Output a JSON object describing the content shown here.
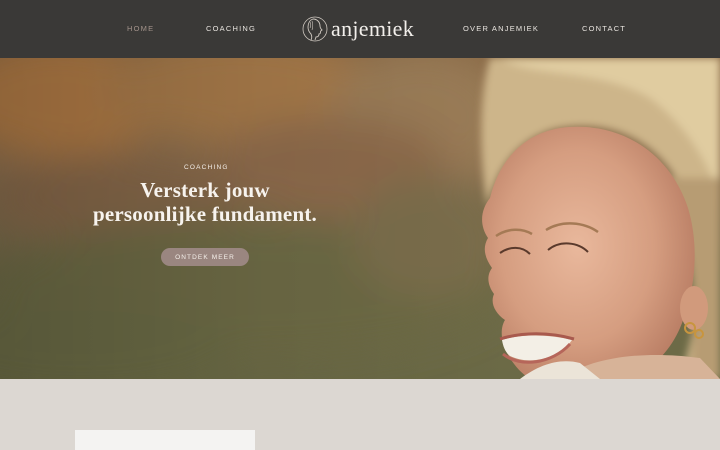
{
  "nav": {
    "left_links": [
      {
        "label": "HOME",
        "active": true
      },
      {
        "label": "COACHING",
        "active": false
      }
    ],
    "right_links": [
      {
        "label": "OVER ANJEMIEK",
        "active": false
      },
      {
        "label": "CONTACT",
        "active": false
      }
    ],
    "logo": {
      "text": "anjemiek",
      "icon": "profile-face-logo-icon"
    }
  },
  "hero": {
    "eyebrow": "COACHING",
    "title_line1": "Versterk jouw",
    "title_line2": "persoonlijke fundament.",
    "cta_label": "ONTDEK MEER"
  },
  "colors": {
    "nav_bg": "#3a3937",
    "nav_active": "#a2928a",
    "cta_bg": "#9a8680",
    "section_bg": "#dcd7d2",
    "card_bg": "#f4f3f2"
  }
}
